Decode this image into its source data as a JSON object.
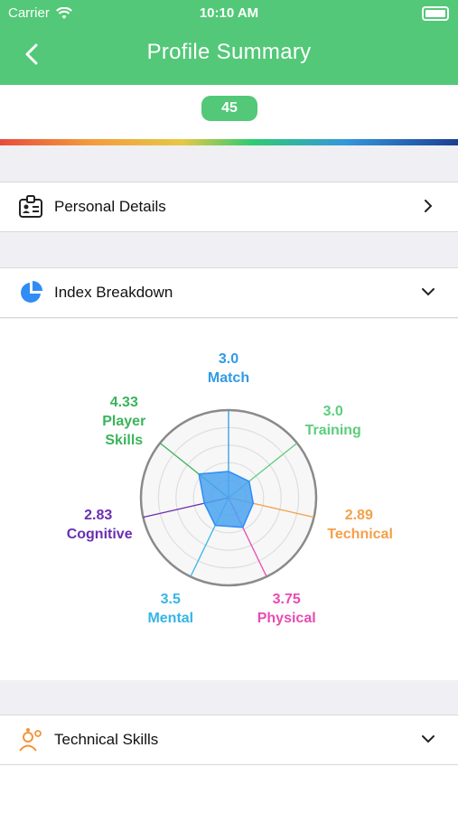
{
  "status": {
    "carrier": "Carrier",
    "time": "10:10 AM"
  },
  "nav": {
    "title": "Profile Summary"
  },
  "score": {
    "value": "45"
  },
  "sections": {
    "personal": "Personal Details",
    "index": "Index Breakdown",
    "technical": "Technical Skills"
  },
  "chart_data": {
    "type": "radar",
    "max": 10,
    "axes": [
      {
        "label": "Match",
        "value": "3.0",
        "color": "#2f9be6"
      },
      {
        "label": "Training",
        "value": "3.0",
        "color": "#5ccd7e"
      },
      {
        "label": "Technical",
        "value": "2.89",
        "color": "#f5a04a"
      },
      {
        "label": "Physical",
        "value": "3.75",
        "color": "#e94bb3"
      },
      {
        "label": "Mental",
        "value": "3.5",
        "color": "#35b6e6"
      },
      {
        "label": "Cognitive",
        "value": "2.83",
        "color": "#6a2fb0"
      },
      {
        "label": "Player Skills",
        "value": "4.33",
        "color": "#39b45a"
      }
    ]
  },
  "colors": {
    "accent": "#53c878",
    "fill": "#4aa3f0"
  }
}
